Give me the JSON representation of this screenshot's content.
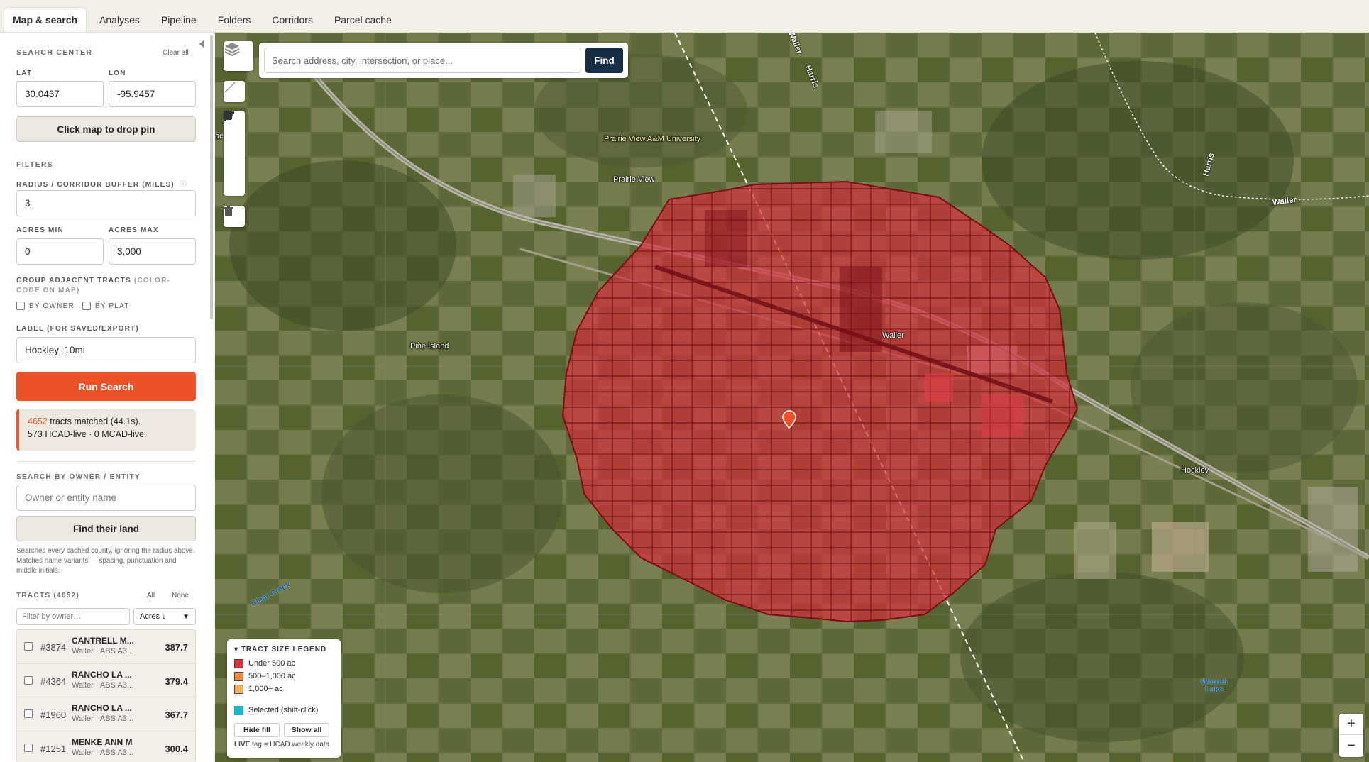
{
  "nav": {
    "tabs": [
      "Map & search",
      "Analyses",
      "Pipeline",
      "Folders",
      "Corridors",
      "Parcel cache"
    ],
    "active": 0
  },
  "sidebar": {
    "search_center_title": "SEARCH CENTER",
    "clear_all": "Clear all",
    "lat_label": "LAT",
    "lat_value": "30.0437",
    "lon_label": "LON",
    "lon_value": "-95.9457",
    "drop_pin": "Click map to drop pin",
    "filters_title": "FILTERS",
    "radius_label": "RADIUS / CORRIDOR BUFFER (MILES)",
    "radius_info_icon": "ⓘ",
    "radius_value": "3",
    "acres_min_label": "ACRES MIN",
    "acres_min_value": "0",
    "acres_max_label": "ACRES MAX",
    "acres_max_value": "3,000",
    "group_label_main": "GROUP ADJACENT TRACTS",
    "group_label_sub": "(COLOR-CODE ON MAP)",
    "by_owner": "BY OWNER",
    "by_plat": "BY PLAT",
    "label_label": "LABEL (FOR SAVED/EXPORT)",
    "label_value": "Hockley_10mi",
    "run_search": "Run Search",
    "result_count": "4652",
    "result_line1_rest": " tracts matched (44.1s).",
    "result_line2": "573 HCAD-live · 0 MCAD-live.",
    "owner_title": "SEARCH BY OWNER / ENTITY",
    "owner_placeholder": "Owner or entity name",
    "find_land": "Find their land",
    "owner_note": "Searches every cached county, ignoring the radius above. Matches name variants — spacing, punctuation and middle initials.",
    "tracts_title": "TRACTS (4652)",
    "all": "All",
    "none": "None",
    "filter_placeholder": "Filter by owner…",
    "sort_value": "Acres ↓",
    "tracts": [
      {
        "num": "#3874",
        "name": "CANTRELL M...",
        "sub": "Waller · ABS A3...",
        "acres": "387.7"
      },
      {
        "num": "#4364",
        "name": "RANCHO LA ...",
        "sub": "Waller · ABS A3...",
        "acres": "379.4"
      },
      {
        "num": "#1960",
        "name": "RANCHO LA ...",
        "sub": "Waller · ABS A3...",
        "acres": "367.7"
      },
      {
        "num": "#1251",
        "name": "MENKE ANN M",
        "sub": "Waller · ABS A3...",
        "acres": "300.4"
      }
    ]
  },
  "map": {
    "search_placeholder": "Search address, city, intersection, or place...",
    "find_button": "Find",
    "places": {
      "pvamu": "Prairie View A&M University",
      "prairie_view": "Prairie View",
      "pine_island": "Pine Island",
      "waller": "Waller",
      "hockley": "Hockley",
      "ac_partial": "ac"
    },
    "roads": {
      "waller_top": "Waller",
      "harris_top": "Harris",
      "harris_right": "Harris",
      "waller_right": "Waller"
    },
    "water": {
      "clear_creek": "Clear Creek",
      "warren_lake": "Warren Lake"
    },
    "legend": {
      "title": "TRACT SIZE LEGEND",
      "items": [
        {
          "label": "Under 500 ac",
          "color": "#d8343c"
        },
        {
          "label": "500–1,000 ac",
          "color": "#f08a3c"
        },
        {
          "label": "1,000+ ac",
          "color": "#f2b255"
        }
      ],
      "selected": {
        "label": "Selected (shift-click)",
        "color": "#1fb5c8"
      },
      "hide_fill": "Hide fill",
      "show_all": "Show all",
      "foot_live": "LIVE",
      "foot_rest": " tag = HCAD weekly data"
    },
    "zoom_in": "+",
    "zoom_out": "−"
  }
}
